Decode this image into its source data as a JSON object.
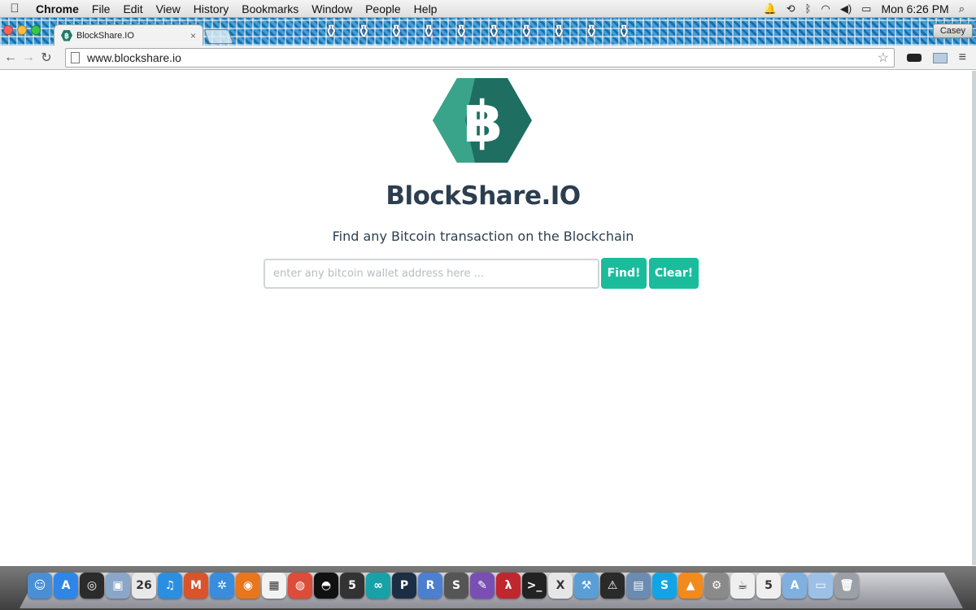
{
  "menubar": {
    "app_name": "Chrome",
    "menus": [
      "File",
      "Edit",
      "View",
      "History",
      "Bookmarks",
      "Window",
      "People",
      "Help"
    ],
    "clock": "Mon 6:26 PM"
  },
  "browser": {
    "tab_title": "BlockShare.IO",
    "tab_close": "×",
    "profile_name": "Casey",
    "url": "www.blockshare.io"
  },
  "page": {
    "logo_glyph": "฿",
    "site_title": "BlockShare.IO",
    "tagline": "Find any Bitcoin transaction on the Blockchain",
    "search_placeholder": "enter any bitcoin wallet address here ...",
    "find_label": "Find!",
    "clear_label": "Clear!",
    "colors": {
      "accent": "#1abc9c",
      "title": "#2c3e50",
      "logo_dark": "#1f6e62",
      "logo_light": "#3aa48a"
    }
  },
  "dock": {
    "apps": [
      {
        "name": "finder-icon",
        "color": "#4a8fd6",
        "glyph": "☺"
      },
      {
        "name": "app-store-icon",
        "color": "#2f86e8",
        "glyph": "A"
      },
      {
        "name": "dashboard-icon",
        "color": "#2b2b2b",
        "glyph": "◎"
      },
      {
        "name": "preview-icon",
        "color": "#8aa7c9",
        "glyph": "▣"
      },
      {
        "name": "calendar-icon",
        "color": "#e8e8e8",
        "glyph": "26"
      },
      {
        "name": "itunes-icon",
        "color": "#2a8fe0",
        "glyph": "♫"
      },
      {
        "name": "mario-icon",
        "color": "#d9542c",
        "glyph": "M"
      },
      {
        "name": "safari-icon",
        "color": "#3a8ddc",
        "glyph": "✲"
      },
      {
        "name": "firefox-icon",
        "color": "#e8761c",
        "glyph": "◉"
      },
      {
        "name": "launchpad-icon",
        "color": "#f2f2f2",
        "glyph": "▦"
      },
      {
        "name": "chrome-icon",
        "color": "#dd4b39",
        "glyph": "◍"
      },
      {
        "name": "ableton-live-icon",
        "color": "#111",
        "glyph": "◓"
      },
      {
        "name": "app-5-icon",
        "color": "#333",
        "glyph": "5"
      },
      {
        "name": "arduino-icon",
        "color": "#17a2a8",
        "glyph": "∞"
      },
      {
        "name": "p-app-icon",
        "color": "#1c2e44",
        "glyph": "P"
      },
      {
        "name": "r-app-icon",
        "color": "#4c7fd0",
        "glyph": "R"
      },
      {
        "name": "sublime-text-icon",
        "color": "#555",
        "glyph": "S"
      },
      {
        "name": "emacs-icon",
        "color": "#7a4fb3",
        "glyph": "✎"
      },
      {
        "name": "lambda-app-icon",
        "color": "#c0262e",
        "glyph": "λ"
      },
      {
        "name": "terminal-icon",
        "color": "#222",
        "glyph": ">_"
      },
      {
        "name": "x11-icon",
        "color": "#e6e6e6",
        "glyph": "X"
      },
      {
        "name": "xcode-icon",
        "color": "#5a9ed8",
        "glyph": "⚒"
      },
      {
        "name": "console-icon",
        "color": "#2a2a2a",
        "glyph": "⚠"
      },
      {
        "name": "screens-icon",
        "color": "#6c8bb0",
        "glyph": "▤"
      },
      {
        "name": "skype-icon",
        "color": "#12a5e6",
        "glyph": "S"
      },
      {
        "name": "vlc-icon",
        "color": "#f28a1c",
        "glyph": "▲"
      },
      {
        "name": "system-prefs-icon",
        "color": "#8a8a8a",
        "glyph": "⚙"
      },
      {
        "name": "jar-file-icon",
        "color": "#efefef",
        "glyph": "☕"
      },
      {
        "name": "html5-file-icon",
        "color": "#efefef",
        "glyph": "5"
      },
      {
        "name": "applications-folder-icon",
        "color": "#7fb0e0",
        "glyph": "A"
      },
      {
        "name": "documents-folder-icon",
        "color": "#9cc0e6",
        "glyph": "▭"
      },
      {
        "name": "trash-icon",
        "color": "#9aa0a6",
        "glyph": "🗑"
      }
    ]
  }
}
